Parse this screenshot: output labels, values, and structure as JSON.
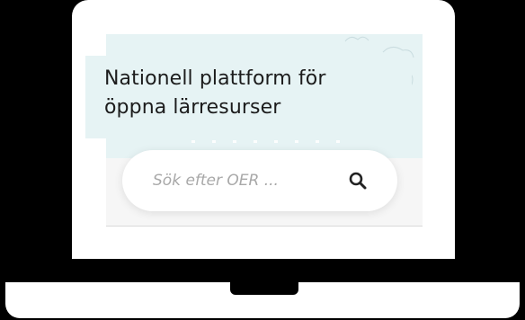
{
  "hero": {
    "title": "Nationell plattform för öppna lärresurser"
  },
  "search": {
    "placeholder": "Sök efter OER ...",
    "value": "",
    "button_icon": "search-icon"
  },
  "colors": {
    "page_background": "#000000",
    "laptop_body": "#ffffff",
    "hero_background": "#e6f3f4",
    "title_text": "#1c1c1c",
    "placeholder_text": "#a8a8a8",
    "icon": "#222222"
  }
}
